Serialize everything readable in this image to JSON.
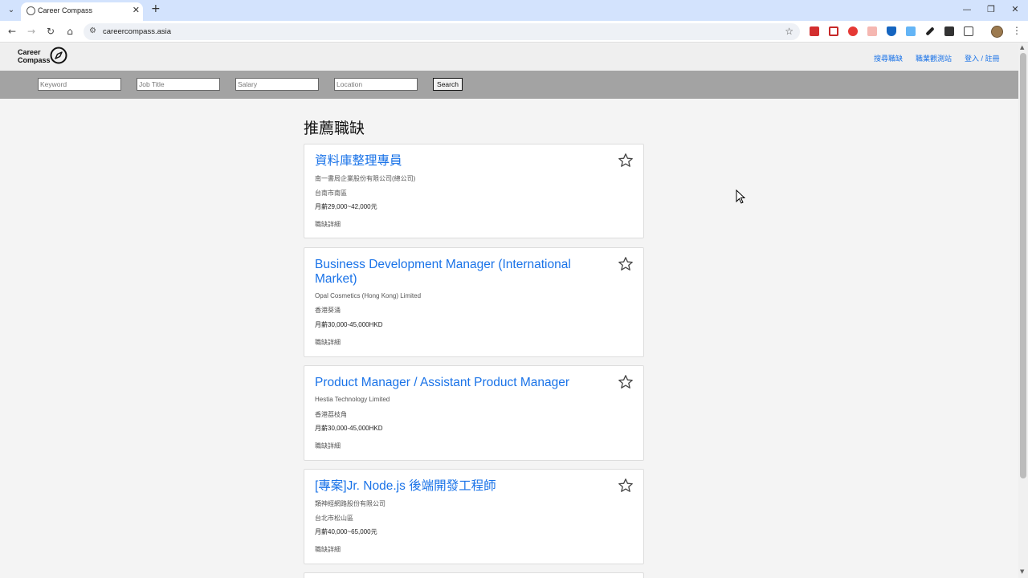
{
  "browser": {
    "tab_title": "Career Compass",
    "url": "careercompass.asia"
  },
  "site": {
    "logo_line1": "Career",
    "logo_line2": "Compass",
    "nav": {
      "search_jobs": "搜尋職缺",
      "career_test": "職業觀測站",
      "login": "登入 / 註冊"
    }
  },
  "search": {
    "keyword_placeholder": "Keyword",
    "job_title_placeholder": "Job Title",
    "salary_placeholder": "Salary",
    "location_placeholder": "Location",
    "button_label": "Search"
  },
  "main": {
    "section_title": "推薦職缺",
    "jobs": [
      {
        "title": "資料庫整理專員",
        "company": "南一書局企業股份有限公司(總公司)",
        "location": "台南市南區",
        "salary": "月薪29,000~42,000元",
        "detail_label": "職缺詳細"
      },
      {
        "title": "Business Development Manager (International Market)",
        "company": "Opal Cosmetics (Hong Kong) Limited",
        "location": "香港葵涌",
        "salary": "月薪30,000-45,000HKD",
        "detail_label": "職缺詳細"
      },
      {
        "title": "Product Manager / Assistant Product Manager",
        "company": "Hestia Technology Limited",
        "location": "香港荔枝角",
        "salary": "月薪30,000-45,000HKD",
        "detail_label": "職缺詳細"
      },
      {
        "title": "[專案]Jr. Node.js 後端開發工程師",
        "company": "類神經網路股份有限公司",
        "location": "台北市松山區",
        "salary": "月薪40,000~65,000元",
        "detail_label": "職缺詳細"
      }
    ]
  },
  "colors": {
    "link_blue": "#1a73e8",
    "search_bar_bg": "#a3a3a3",
    "chrome_tab_bg": "#d3e3fd"
  }
}
